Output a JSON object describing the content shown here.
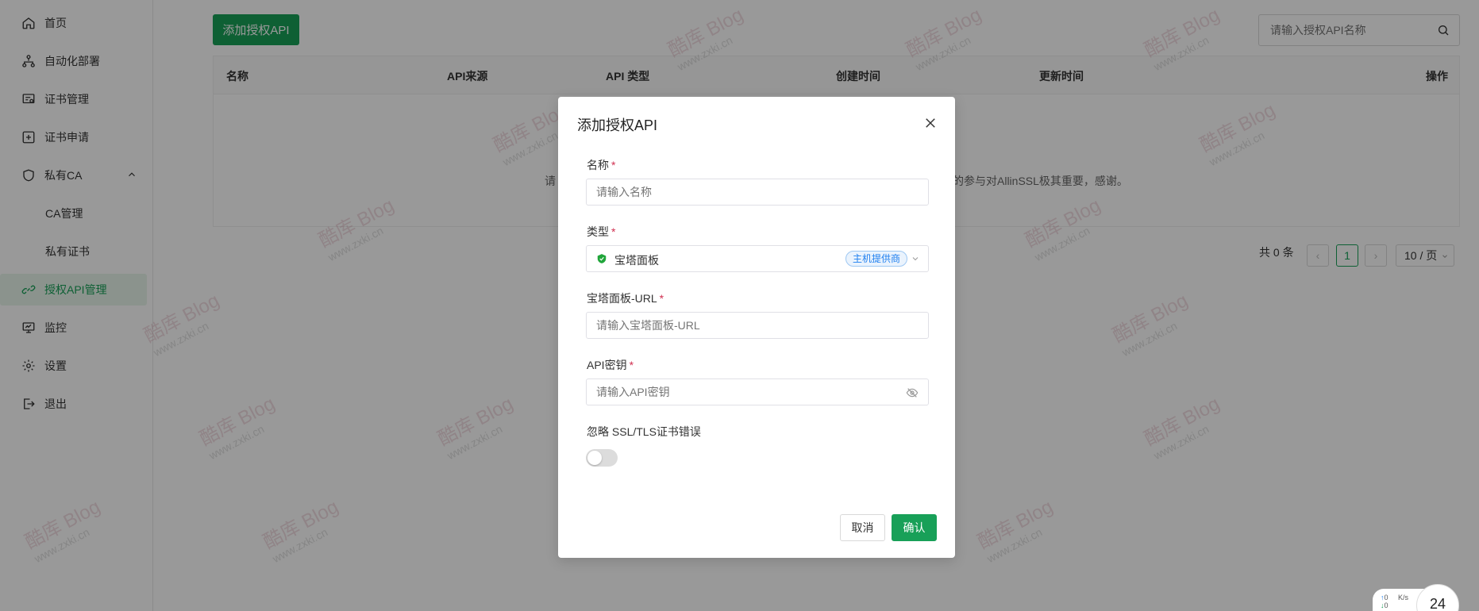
{
  "sidebar": {
    "items": [
      {
        "label": "首页",
        "icon": "home-icon"
      },
      {
        "label": "自动化部署",
        "icon": "workflow-icon"
      },
      {
        "label": "证书管理",
        "icon": "certificate-icon"
      },
      {
        "label": "证书申请",
        "icon": "plus-square-icon"
      },
      {
        "label": "私有CA",
        "icon": "shield-icon"
      },
      {
        "label": "CA管理"
      },
      {
        "label": "私有证书"
      },
      {
        "label": "授权API管理",
        "icon": "api-link-icon"
      },
      {
        "label": "监控",
        "icon": "monitor-icon"
      },
      {
        "label": "设置",
        "icon": "gear-icon"
      },
      {
        "label": "退出",
        "icon": "logout-icon"
      }
    ]
  },
  "toolbar": {
    "add_label": "添加授权API",
    "search_placeholder": "请输入授权API名称"
  },
  "table": {
    "columns": [
      "名称",
      "API来源",
      "API 类型",
      "创建时间",
      "更新时间",
      "操作"
    ],
    "empty_left": "请",
    "empty_right": "的参与对AllinSSL极其重要，感谢。"
  },
  "pagination": {
    "total": "共 0 条",
    "current": "1",
    "page_size": "10 / 页"
  },
  "watermark": {
    "brand": "酷库 Blog",
    "site": "www.zxki.cn"
  },
  "modal": {
    "title": "添加授权API",
    "name_label": "名称",
    "name_placeholder": "请输入名称",
    "type_label": "类型",
    "type_value": "宝塔面板",
    "type_tag": "主机提供商",
    "url_label": "宝塔面板-URL",
    "url_placeholder": "请输入宝塔面板-URL",
    "key_label": "API密钥",
    "key_placeholder": "请输入API密钥",
    "ssl_label": "忽略 SSL/TLS证书错误",
    "ssl_enabled": false,
    "required_mark": "*",
    "cancel_label": "取消",
    "ok_label": "确认"
  },
  "speed_widget": {
    "up": "0",
    "down": "0",
    "unit": "K/s",
    "value": "24"
  },
  "colors": {
    "primary": "#18a058",
    "required": "#d03050",
    "tag": "#2080f0"
  }
}
